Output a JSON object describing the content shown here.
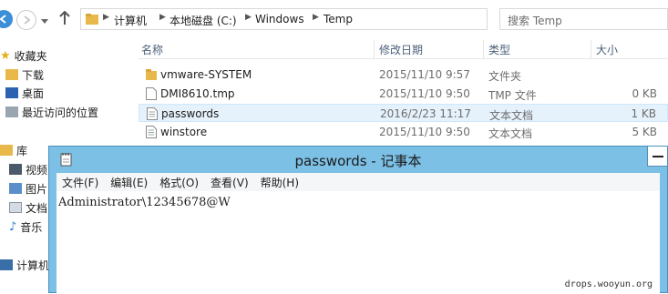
{
  "nav": {
    "breadcrumb": [
      "计算机",
      "本地磁盘 (C:)",
      "Windows",
      "Temp"
    ],
    "search_placeholder": "搜索 Temp"
  },
  "sidebar": {
    "favorites": "收藏夹",
    "items": [
      {
        "label": "下载",
        "icon": "download-folder-icon"
      },
      {
        "label": "桌面",
        "icon": "desktop-icon"
      },
      {
        "label": "最近访问的位置",
        "icon": "recent-places-icon"
      }
    ],
    "library": "库",
    "library_items": [
      "视频",
      "图片",
      "文档",
      "音乐"
    ],
    "computer": "计算机"
  },
  "columns": [
    "名称",
    "修改日期",
    "类型",
    "大小"
  ],
  "files": [
    {
      "name": "vmware-SYSTEM",
      "date": "2015/11/10 9:57",
      "type": "文件夹",
      "size": "",
      "icon": "folder-icon"
    },
    {
      "name": "DMI8610.tmp",
      "date": "2015/11/10 9:50",
      "type": "TMP 文件",
      "size": "0 KB",
      "icon": "file-icon"
    },
    {
      "name": "passwords",
      "date": "2016/2/23 11:17",
      "type": "文本文档",
      "size": "1 KB",
      "icon": "text-file-icon"
    },
    {
      "name": "winstore",
      "date": "2015/11/10 9:50",
      "type": "文本文档",
      "size": "5 KB",
      "icon": "text-file-icon"
    }
  ],
  "notepad": {
    "title": "passwords - 记事本",
    "menu": [
      "文件(F)",
      "编辑(E)",
      "格式(O)",
      "查看(V)",
      "帮助(H)"
    ],
    "content": "Administrator\\12345678@W"
  },
  "watermark": "drops.wooyun.org",
  "colors": {
    "titlebar": "#7dc0e6",
    "selected_row": "#e5f1fb",
    "header_text": "#4c607a"
  }
}
